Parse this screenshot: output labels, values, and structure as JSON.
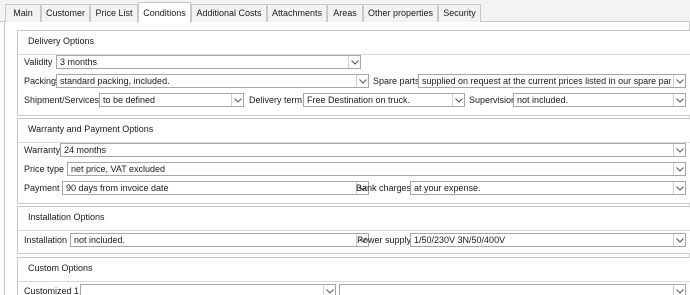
{
  "tabs": [
    {
      "label": "Main"
    },
    {
      "label": "Customer"
    },
    {
      "label": "Price List"
    },
    {
      "label": "Conditions",
      "active": true
    },
    {
      "label": "Additional Costs"
    },
    {
      "label": "Attachments"
    },
    {
      "label": "Areas"
    },
    {
      "label": "Other properties"
    },
    {
      "label": "Security"
    }
  ],
  "delivery": {
    "title": "Delivery Options",
    "validity_label": "Validity",
    "validity_value": "3 months",
    "packing_label": "Packing",
    "packing_value": "standard packing, included.",
    "spare_parts_label": "Spare parts",
    "spare_parts_value": "supplied on request at the current prices listed in our spare parts pric",
    "shipment_label": "Shipment/Services",
    "shipment_value": "to be defined",
    "delivery_term_label": "Delivery term",
    "delivery_term_value": "Free Destination on truck.",
    "supervision_label": "Supervision",
    "supervision_value": "not included."
  },
  "warranty": {
    "title": "Warranty and Payment Options",
    "warranty_label": "Warranty",
    "warranty_value": "24 months",
    "price_type_label": "Price type",
    "price_type_value": "net price, VAT excluded",
    "payment_label": "Payment",
    "payment_value": "90 days from invoice date",
    "bank_charges_label": "Bank charges",
    "bank_charges_value": "at your expense."
  },
  "installation": {
    "title": "Installation Options",
    "installation_label": "Installation",
    "installation_value": "not included.",
    "power_supply_label": "Power supply",
    "power_supply_value": "1/50/230V 3N/50/400V"
  },
  "custom": {
    "title": "Custom Options",
    "customized1_label": "Customized 1",
    "customized1_value": "",
    "customized1_extra_value": ""
  }
}
